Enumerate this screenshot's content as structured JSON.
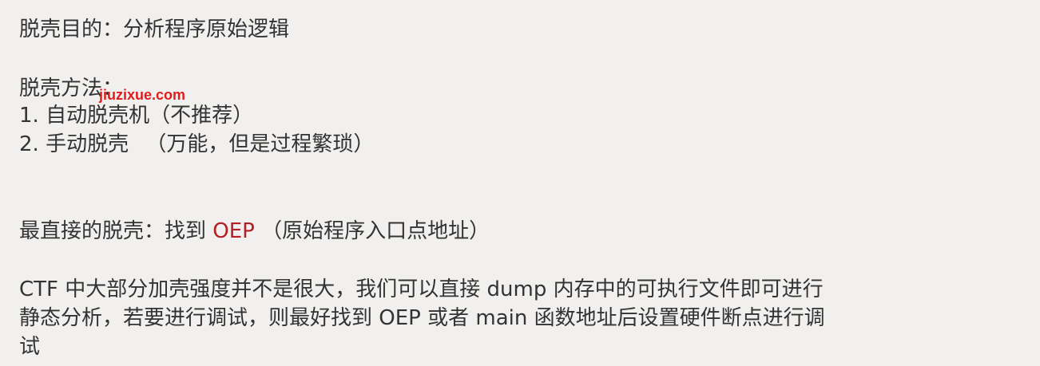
{
  "goal": {
    "text": "脱壳目的：分析程序原始逻辑"
  },
  "methods": {
    "heading": "脱壳方法：",
    "items": [
      "1. 自动脱壳机（不推荐）",
      "2. 手动脱壳 　（万能，但是过程繁琐）"
    ]
  },
  "direct": {
    "prefix": "最直接的脱壳：找到 ",
    "highlight": "OEP",
    "suffix": " （原始程序入口点地址）",
    "highlight_color": "#b21f24"
  },
  "paragraph": {
    "lines": [
      "CTF 中大部分加壳强度并不是很大，我们可以直接 dump 内存中的可执行文件即可进行",
      "静态分析，若要进行调试，则最好找到 OEP 或者 main 函数地址后设置硬件断点进行调",
      "试"
    ]
  },
  "watermark": {
    "text": "jiuzixue.com",
    "color": "#e01c1c"
  }
}
